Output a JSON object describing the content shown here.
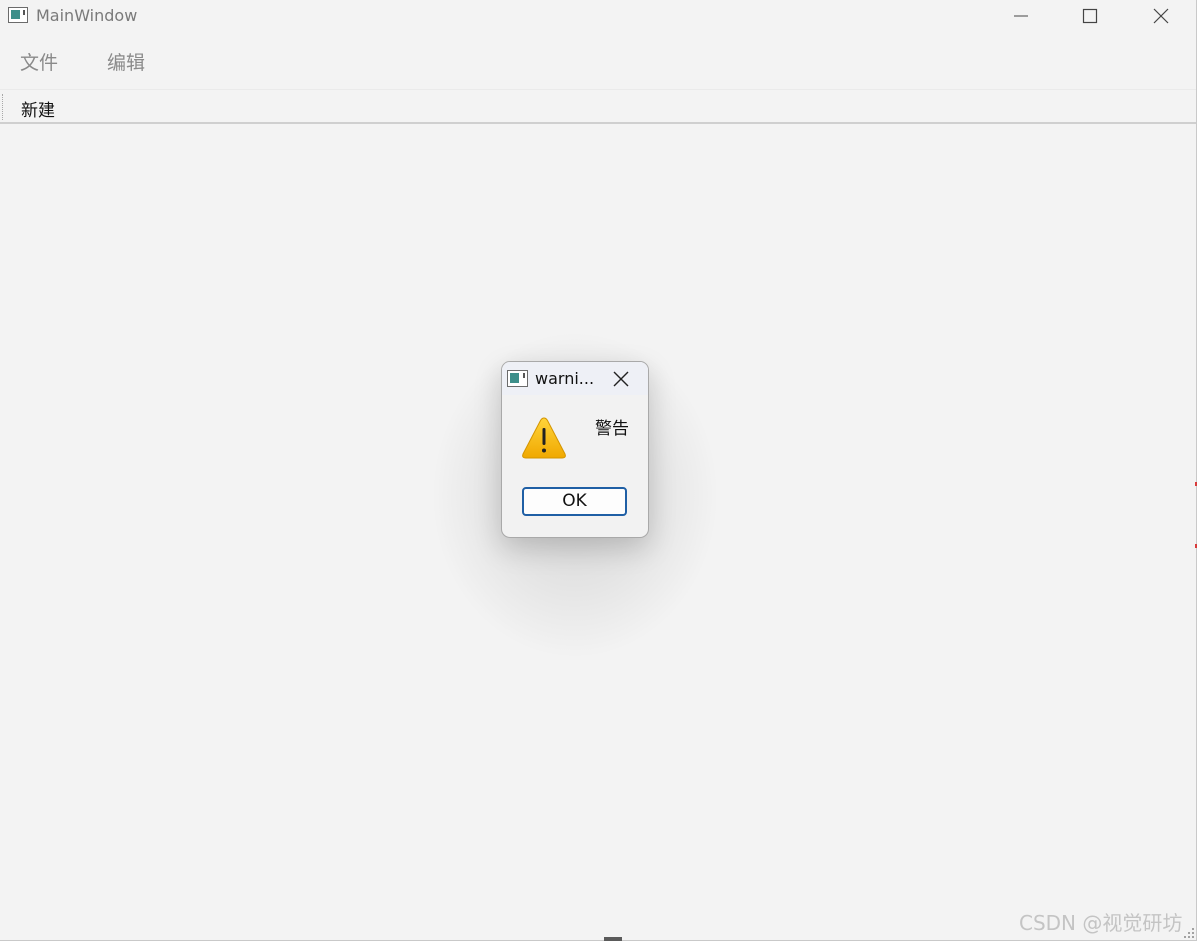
{
  "window": {
    "title": "MainWindow",
    "icon": "qt-window-icon"
  },
  "titlebar_buttons": {
    "minimize_icon": "minimize-icon",
    "maximize_icon": "maximize-icon",
    "close_icon": "close-icon"
  },
  "menubar": {
    "items": [
      {
        "label": "文件"
      },
      {
        "label": "编辑"
      }
    ]
  },
  "toolbar": {
    "new_label": "新建"
  },
  "dialog": {
    "title": "warni...",
    "message": "警告",
    "ok_label": "OK",
    "icon": "warning-icon",
    "warning_color": "#f5b800"
  },
  "watermark": {
    "text": "CSDN @视觉研坊"
  }
}
